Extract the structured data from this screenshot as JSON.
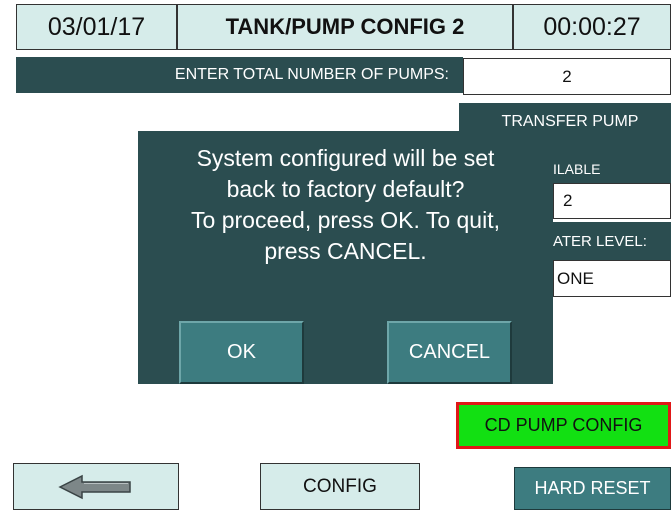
{
  "header": {
    "date": "03/01/17",
    "title": "TANK/PUMP CONFIG 2",
    "time": "00:00:27"
  },
  "pumps": {
    "label": "ENTER TOTAL NUMBER OF PUMPS:",
    "value": "2"
  },
  "transfer_pump": {
    "label": "TRANSFER PUMP",
    "available_label_partial": "ILABLE",
    "available_value": "2",
    "water_level_label_partial": "ATER LEVEL:",
    "water_level_value_partial": "ONE"
  },
  "dialog": {
    "message": "System configured will be set\nback to factory default?\nTo proceed, press OK. To quit,\npress CANCEL.",
    "ok_label": "OK",
    "cancel_label": "CANCEL"
  },
  "buttons": {
    "cd_pump_config": "CD PUMP CONFIG",
    "config": "CONFIG",
    "hard_reset": "HARD RESET"
  },
  "icons": {
    "back": "arrow-left-icon"
  },
  "colors": {
    "panel_dark": "#2b4d50",
    "button_teal": "#3d7c80",
    "header_bg": "#d6ecea",
    "highlight_green": "#12e012",
    "highlight_border_red": "#e01818"
  }
}
